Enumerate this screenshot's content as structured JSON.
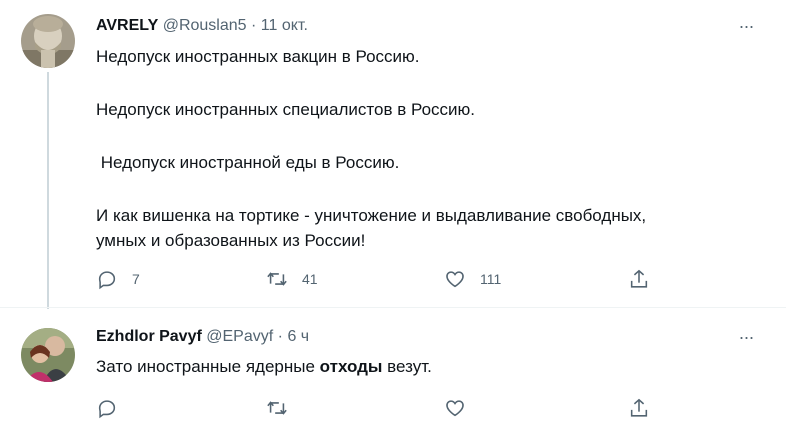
{
  "tweets": [
    {
      "author": "AVRELY",
      "handle": "@Rouslan5",
      "separator": "·",
      "time": "11 окт.",
      "paragraphs": [
        "Недопуск иностранных вакцин в Россию.",
        "Недопуск иностранных специалистов в Россию.",
        " Недопуск иностранной еды в Россию.",
        "И как вишенка на тортике - уничтожение и выдавливание свободных,\nумных и образованных из России!"
      ],
      "replies": "7",
      "retweets": "41",
      "likes": "111"
    },
    {
      "author": "Ezhdlor Pavyf",
      "handle": "@EPavyf",
      "separator": "·",
      "time": "6 ч",
      "text_before": "Зато иностранные ядерные ",
      "text_bold": "отходы",
      "text_after": " везут.",
      "replies": "",
      "retweets": "",
      "likes": ""
    }
  ],
  "more_label": "···",
  "icons": [
    "more-icon",
    "reply-icon",
    "retweet-icon",
    "like-icon",
    "share-icon"
  ],
  "colors": {
    "text": "#0f1419",
    "secondary": "#536471",
    "thread_line": "#cfd9de",
    "divider": "#eff3f4"
  }
}
